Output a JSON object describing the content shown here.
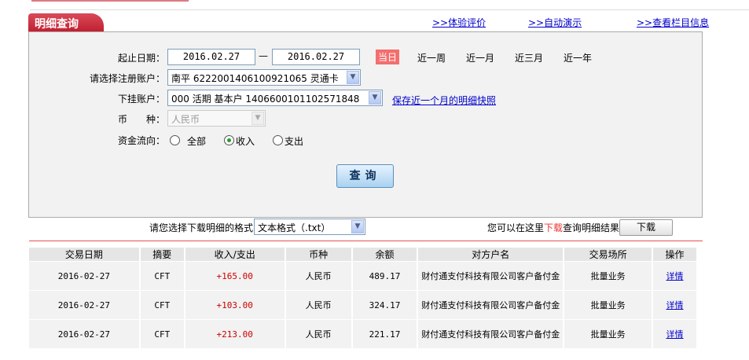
{
  "header": {
    "tab_title": "明细查询",
    "links": [
      ">>体验评价",
      ">>自动演示",
      ">>查看栏目信息"
    ]
  },
  "form": {
    "date_label": "起止日期：",
    "start_date": "2016.02.27",
    "dash": "—",
    "end_date": "2016.02.27",
    "quick_ranges": [
      "当日",
      "近一周",
      "近一月",
      "近三月",
      "近一年"
    ],
    "active_range": "当日",
    "account_label": "请选择注册账户：",
    "account_value": "南平 6222001406100921065 灵通卡",
    "sub_account_label": "下挂账户：",
    "sub_account_value": "000 活期 基本户 1406600101102571848",
    "snapshot_link": "保存近一个月的明细快照",
    "currency_label": "币　　种：",
    "currency_value": "人民币",
    "flow_label": "资金流向：",
    "flow_options": [
      "全部",
      "收入",
      "支出"
    ],
    "flow_selected": "收入",
    "query_button": "查询"
  },
  "download": {
    "format_label": "请您选择下载明细的格式",
    "format_value": "文本格式（.txt）",
    "hint_pre": "您可以在这里",
    "hint_red": "下载",
    "hint_post": "查询明细结果",
    "button": "下载"
  },
  "table": {
    "headers": [
      "交易日期",
      "摘要",
      "收入/支出",
      "币种",
      "余额",
      "对方户名",
      "交易场所",
      "操作"
    ],
    "rows": [
      [
        "2016-02-27",
        "CFT",
        "+165.00",
        "人民币",
        "489.17",
        "财付通支付科技有限公司客户备付金",
        "批量业务",
        "详情"
      ],
      [
        "2016-02-27",
        "CFT",
        "+103.00",
        "人民币",
        "324.17",
        "财付通支付科技有限公司客户备付金",
        "批量业务",
        "详情"
      ],
      [
        "2016-02-27",
        "CFT",
        "+213.00",
        "人民币",
        "221.17",
        "财付通支付科技有限公司客户备付金",
        "批量业务",
        "详情"
      ]
    ]
  },
  "colors": {
    "accent": "#c11f30",
    "active_range_bg": "#f46e6e",
    "amount": "#cc0000",
    "link": "#0000cc"
  }
}
